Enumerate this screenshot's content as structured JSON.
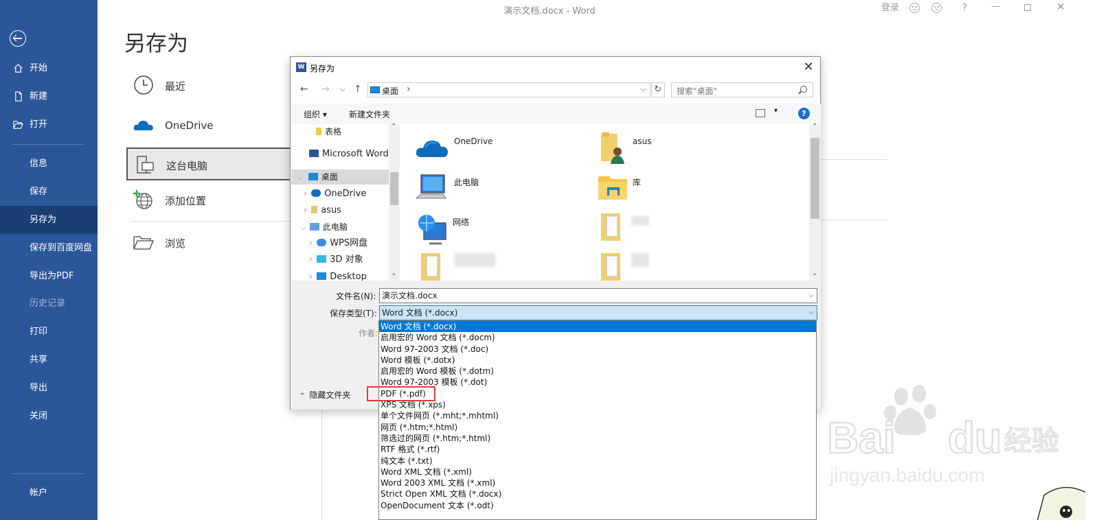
{
  "app_title": "演示文档.docx  -  Word",
  "title_bar": {
    "login": "登录",
    "help": "?"
  },
  "nav": {
    "items": [
      {
        "label": "开始",
        "icon": "home-icon"
      },
      {
        "label": "新建",
        "icon": "new-doc-icon"
      },
      {
        "label": "打开",
        "icon": "open-folder-icon"
      },
      {
        "label": "信息"
      },
      {
        "label": "保存"
      },
      {
        "label": "另存为",
        "active": true
      },
      {
        "label": "保存到百度网盘"
      },
      {
        "label": "导出为PDF"
      },
      {
        "label": "历史记录",
        "disabled": true
      },
      {
        "label": "打印"
      },
      {
        "label": "共享"
      },
      {
        "label": "导出"
      },
      {
        "label": "关闭"
      }
    ],
    "account": "帐户"
  },
  "page_heading": "另存为",
  "locations": [
    {
      "label": "最近",
      "icon": "clock-icon"
    },
    {
      "label": "OneDrive",
      "icon": "onedrive-cloud-icon"
    },
    {
      "label": "这台电脑",
      "icon": "this-pc-icon",
      "selected": true
    },
    {
      "label": "添加位置",
      "icon": "add-place-icon"
    },
    {
      "label": "浏览",
      "icon": "browse-folder-icon"
    }
  ],
  "dialog": {
    "title": "另存为",
    "address": "桌面",
    "search_placeholder": "搜索\"桌面\"",
    "organize": "组织 ▾",
    "new_folder": "新建文件夹",
    "tree": [
      {
        "label": "表格",
        "icon": "folder-icon"
      },
      {
        "label": "Microsoft Word",
        "icon": "word-icon"
      },
      {
        "label": "桌面",
        "icon": "desktop-icon",
        "selected": true
      },
      {
        "label": "OneDrive",
        "icon": "onedrive-cloud-icon"
      },
      {
        "label": "asus",
        "icon": "user-folder-icon"
      },
      {
        "label": "此电脑",
        "icon": "computer-icon"
      },
      {
        "label": "WPS网盘",
        "icon": "wps-cloud-icon"
      },
      {
        "label": "3D 对象",
        "icon": "3d-objects-icon"
      },
      {
        "label": "Desktop",
        "icon": "desktop-icon"
      }
    ],
    "files": [
      {
        "label": "OneDrive",
        "icon": "onedrive-cloud-icon"
      },
      {
        "label": "asus",
        "icon": "user-folder-icon"
      },
      {
        "label": "此电脑",
        "icon": "computer-icon"
      },
      {
        "label": "库",
        "icon": "library-icon"
      },
      {
        "label": "网络",
        "icon": "network-icon"
      }
    ],
    "filename_label": "文件名(N):",
    "filename_value": "演示文档.docx",
    "filetype_label": "保存类型(T):",
    "filetype_value": "Word 文档 (*.docx)",
    "author_label": "作者:",
    "hide_folders": "隐藏文件夹",
    "type_options": [
      "Word 文档 (*.docx)",
      "启用宏的 Word 文档 (*.docm)",
      "Word 97-2003 文档 (*.doc)",
      "Word 模板 (*.dotx)",
      "启用宏的 Word 模板 (*.dotm)",
      "Word 97-2003 模板 (*.dot)",
      "PDF (*.pdf)",
      "XPS 文档 (*.xps)",
      "单个文件网页 (*.mht;*.mhtml)",
      "网页 (*.htm;*.html)",
      "筛选过的网页 (*.htm;*.html)",
      "RTF 格式 (*.rtf)",
      "纯文本 (*.txt)",
      "Word XML 文档 (*.xml)",
      "Word 2003 XML 文档 (*.xml)",
      "Strict Open XML 文档 (*.docx)",
      "OpenDocument 文本 (*.odt)"
    ]
  },
  "watermark": {
    "brand": "Bai",
    "brand2": "du",
    "cn": "经验",
    "url": "jingyan.baidu.com"
  },
  "colors": {
    "nav_bg": "#2b579a",
    "nav_active": "#1a3f72",
    "select_blue": "#0078d7",
    "highlight_red": "#e03a3a"
  }
}
